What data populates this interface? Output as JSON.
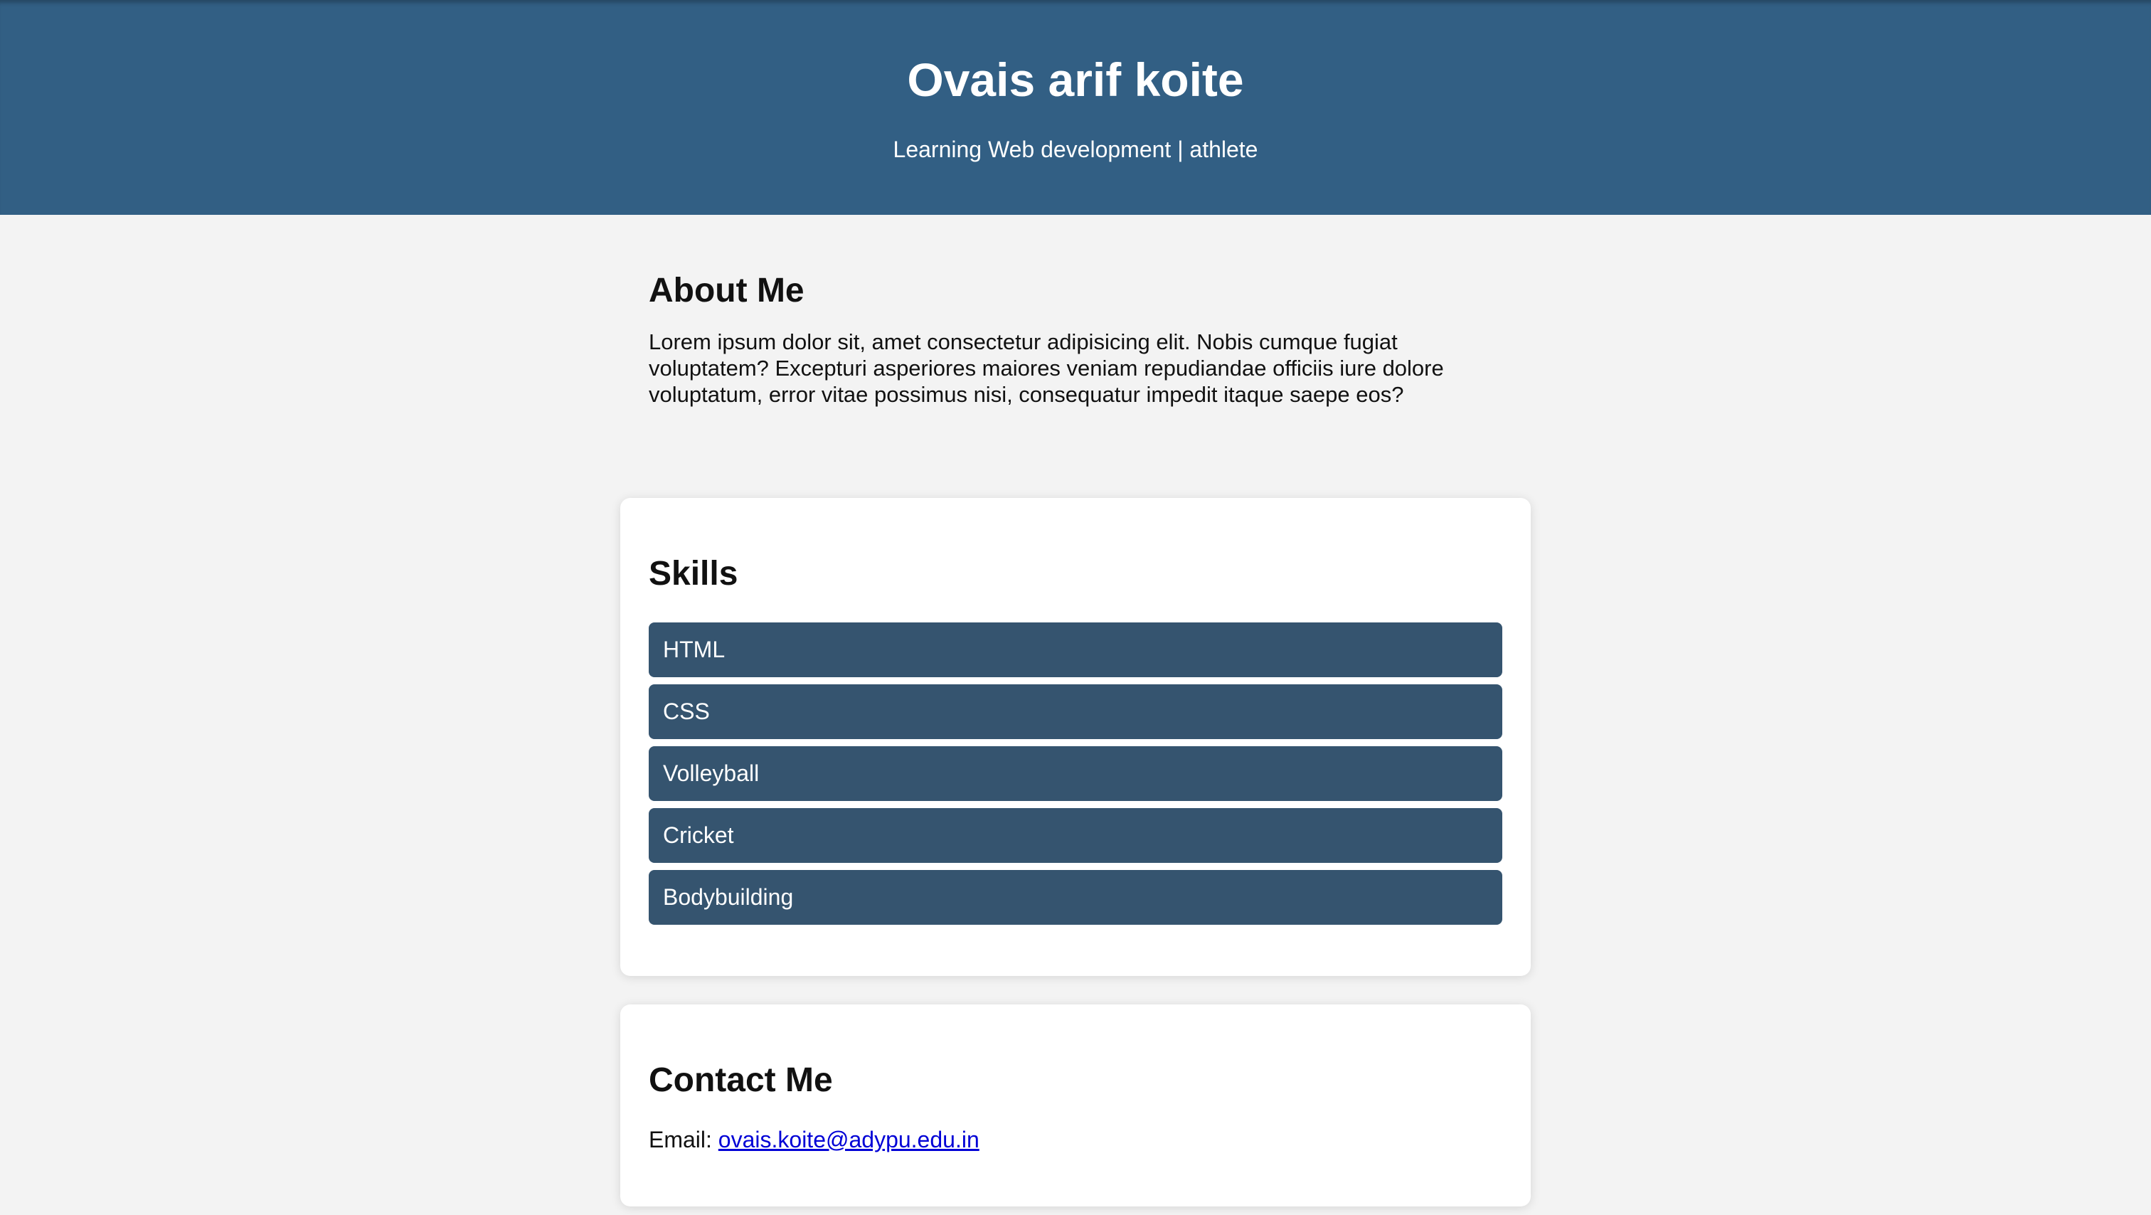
{
  "header": {
    "name": "Ovais arif koite",
    "tagline": "Learning Web development | athlete"
  },
  "about": {
    "heading": "About Me",
    "text": "Lorem ipsum dolor sit, amet consectetur adipisicing elit. Nobis cumque fugiat voluptatem? Excepturi asperiores maiores veniam repudiandae officiis iure dolore voluptatum, error vitae possimus nisi, consequatur impedit itaque saepe eos?"
  },
  "skills": {
    "heading": "Skills",
    "items": [
      {
        "label": "HTML"
      },
      {
        "label": "CSS"
      },
      {
        "label": "Volleyball"
      },
      {
        "label": "Cricket"
      },
      {
        "label": "Bodybuilding"
      }
    ]
  },
  "contact": {
    "heading": "Contact Me",
    "email_label": "Email:",
    "email": "ovais.koite@adypu.edu.in"
  },
  "colors": {
    "header_bg": "#325f84",
    "skill_bg": "#35546f",
    "page_bg": "#f3f3f3",
    "link": "#0000d6"
  }
}
